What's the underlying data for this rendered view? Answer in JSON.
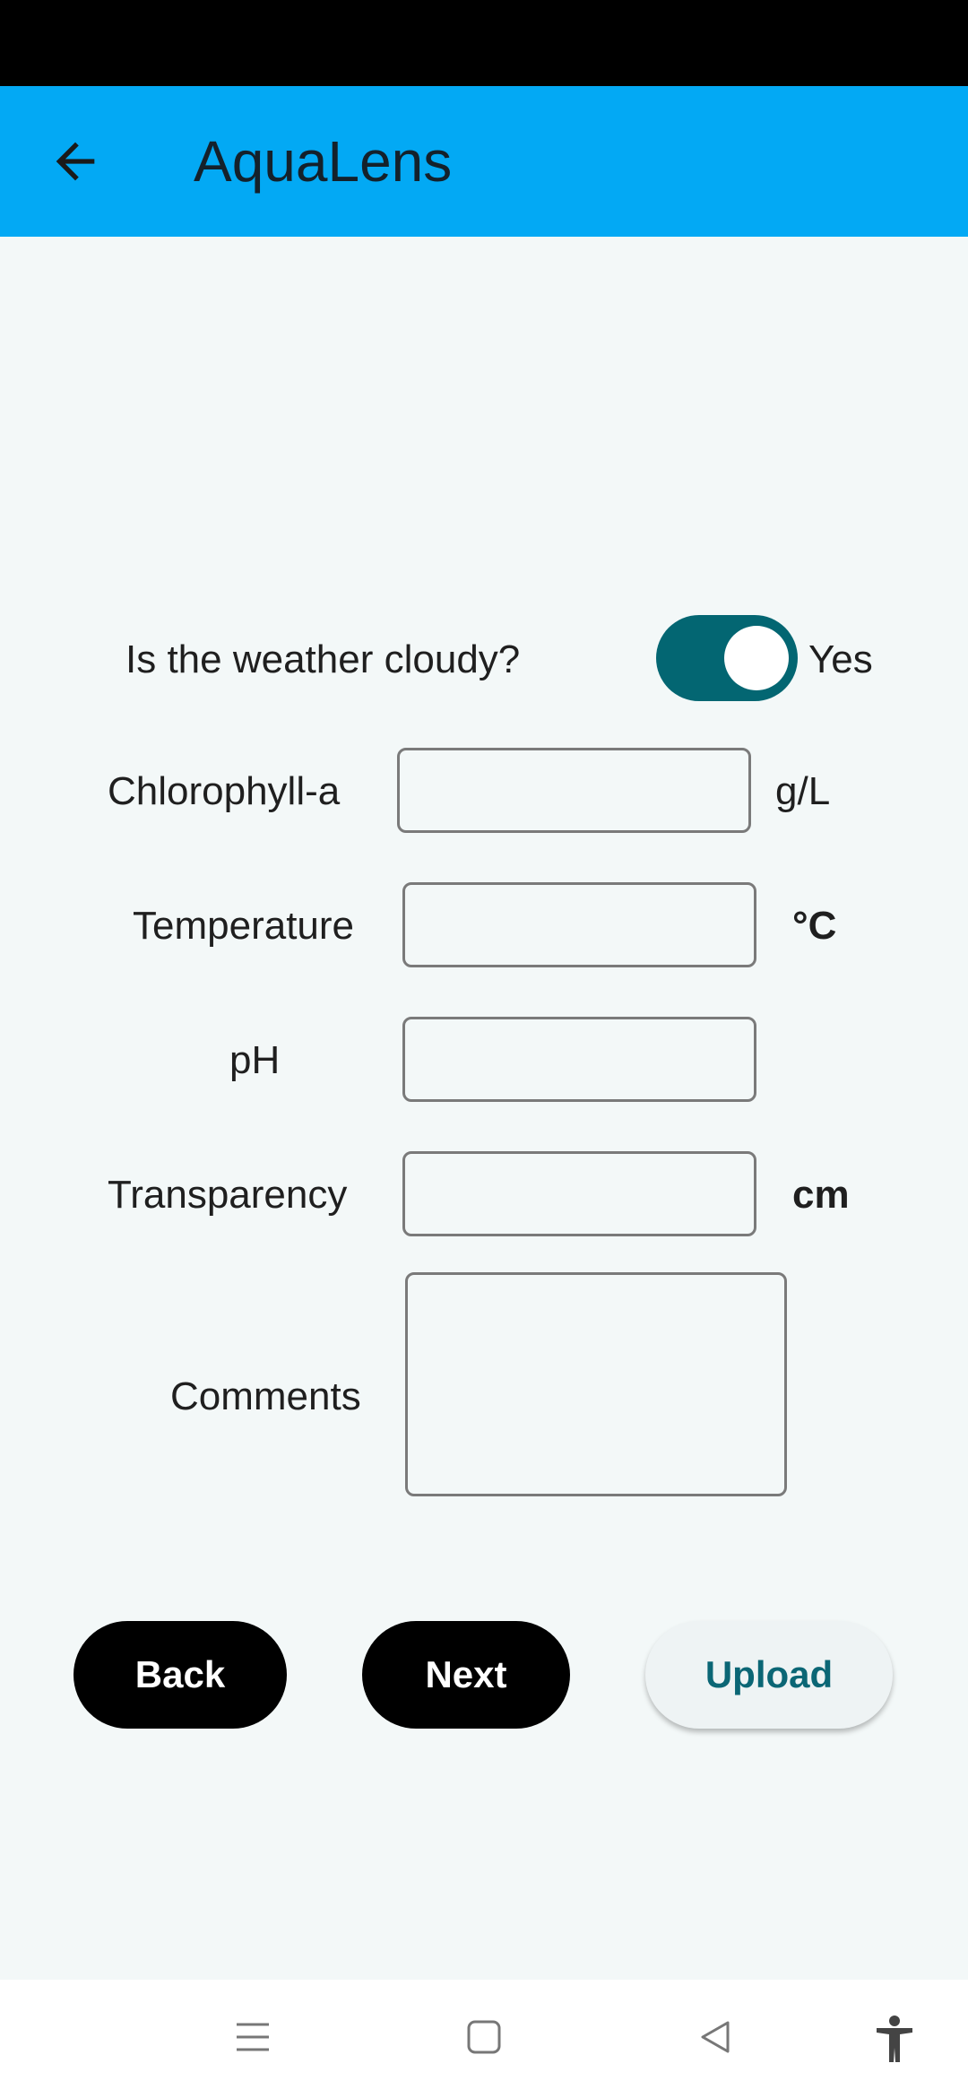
{
  "app": {
    "title": "AquaLens"
  },
  "form": {
    "cloudy_question": "Is the weather cloudy?",
    "cloudy_value": "Yes",
    "chlorophyll_label": "Chlorophyll-a",
    "chlorophyll_unit": "g/L",
    "chlorophyll_value": "",
    "temperature_label": "Temperature",
    "temperature_unit": "°C",
    "temperature_value": "",
    "ph_label": "pH",
    "ph_value": "",
    "transparency_label": "Transparency",
    "transparency_unit": "cm",
    "transparency_value": "",
    "comments_label": "Comments",
    "comments_value": ""
  },
  "buttons": {
    "back": "Back",
    "next": "Next",
    "upload": "Upload"
  },
  "nav": {
    "icons": [
      "menu-icon",
      "home-square-icon",
      "back-triangle-icon",
      "accessibility-icon"
    ]
  },
  "colors": {
    "app_bar": "#03a9f4",
    "toggle": "#036672",
    "upload_text": "#0b6675",
    "background": "#f3f8f8"
  }
}
